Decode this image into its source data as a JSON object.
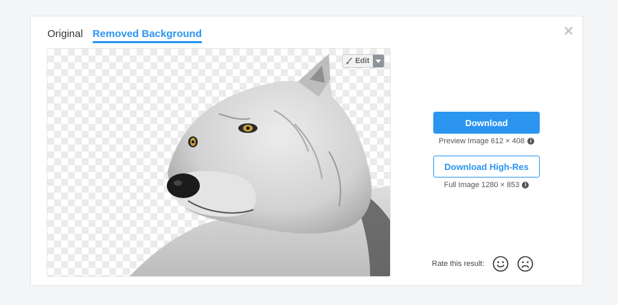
{
  "tabs": {
    "original": "Original",
    "removed": "Removed Background"
  },
  "close_label": "×",
  "edit": {
    "label": "Edit"
  },
  "download": {
    "label": "Download",
    "meta": "Preview Image 612 × 408"
  },
  "download_hr": {
    "label": "Download High-Res",
    "meta": "Full Image 1280 × 853"
  },
  "rating": {
    "label": "Rate this result:"
  },
  "colors": {
    "accent": "#2b95f0",
    "background": "#f4f5f6"
  },
  "icons": {
    "edit": "brush-icon",
    "caret": "caret-down-icon",
    "info": "info-icon",
    "close": "close-icon",
    "happy": "smiley-happy-icon",
    "sad": "smiley-sad-icon"
  }
}
